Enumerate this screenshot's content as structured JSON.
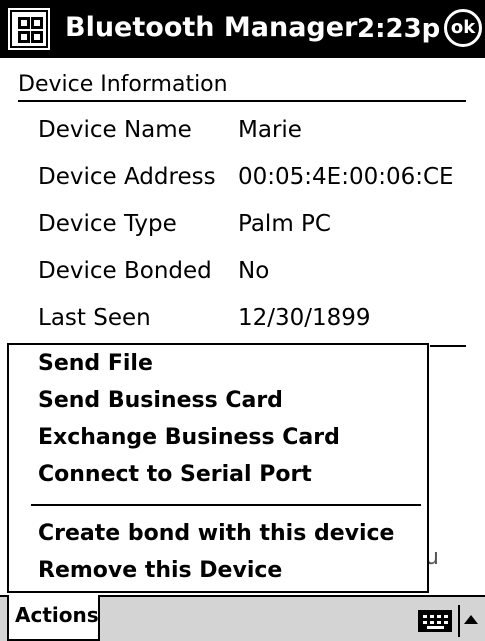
{
  "titlebar": {
    "start_icon": "windows-start-icon",
    "title": "Bluetooth Manager",
    "time": "2:23p",
    "ok_label": "ok"
  },
  "section": {
    "header": "Device Information"
  },
  "device_info": [
    {
      "label": "Device Name",
      "value": "Marie"
    },
    {
      "label": "Device Address",
      "value": "00:05:4E:00:06:CE"
    },
    {
      "label": "Device Type",
      "value": "Palm PC"
    },
    {
      "label": "Device Bonded",
      "value": "No"
    },
    {
      "label": "Last Seen",
      "value": "12/30/1899"
    }
  ],
  "background_partial_text": "u",
  "menu": {
    "group1": [
      "Send File",
      "Send Business Card",
      "Exchange Business Card",
      "Connect to Serial Port"
    ],
    "group2": [
      "Create bond with this device",
      "Remove this Device"
    ]
  },
  "bottombar": {
    "actions_label": "Actions",
    "keyboard_icon": "keyboard-icon",
    "sip_arrow_icon": "arrow-up-icon"
  }
}
